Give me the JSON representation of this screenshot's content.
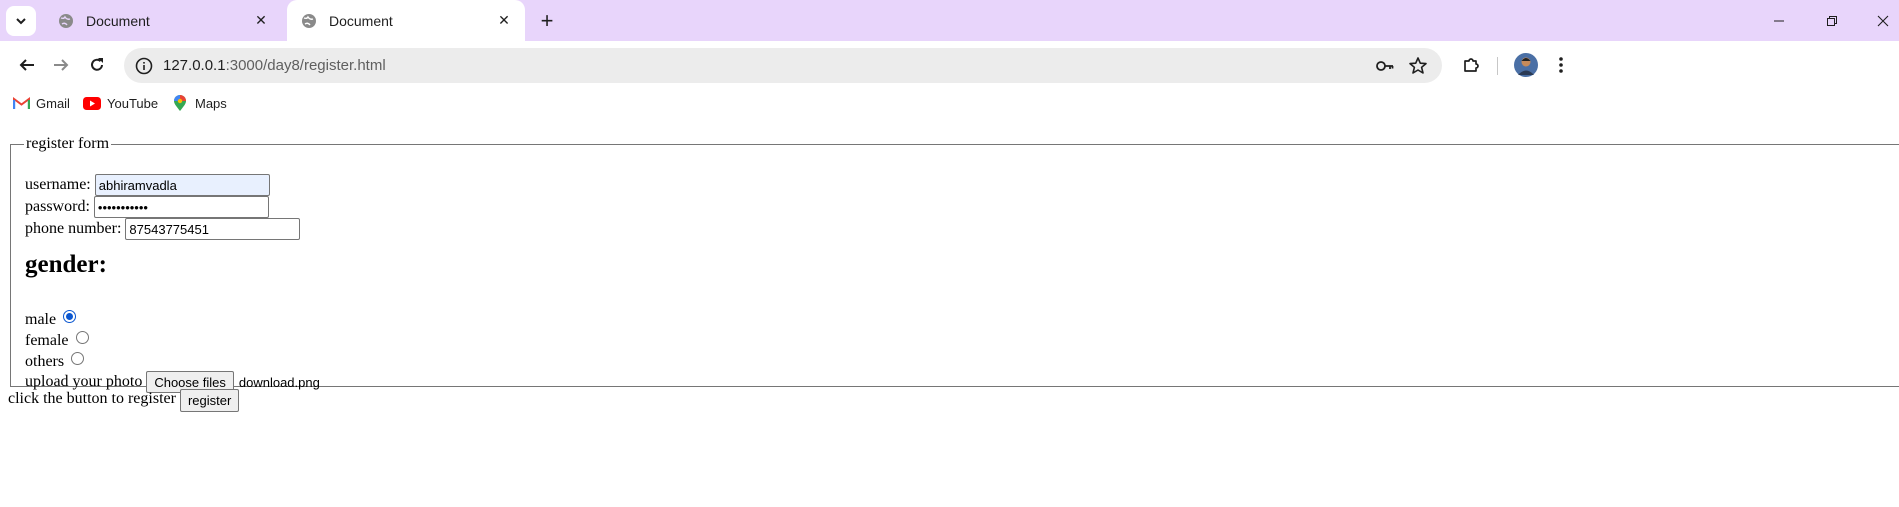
{
  "browser": {
    "tabs": [
      {
        "title": "Document",
        "active": false
      },
      {
        "title": "Document",
        "active": true
      }
    ],
    "address": {
      "host": "127.0.0.1",
      "path": ":3000/day8/register.html"
    },
    "bookmarks": [
      {
        "label": "Gmail",
        "icon": "gmail-icon"
      },
      {
        "label": "YouTube",
        "icon": "youtube-icon"
      },
      {
        "label": "Maps",
        "icon": "maps-icon"
      }
    ]
  },
  "form": {
    "legend": "register form",
    "username": {
      "label": "username:",
      "value": "abhiramvadla"
    },
    "password": {
      "label": "password:",
      "value": "•••••••••••"
    },
    "phone": {
      "label": "phone number:",
      "value": "87543775451"
    },
    "gender_heading": "gender:",
    "gender_options": [
      {
        "label": "male",
        "checked": true
      },
      {
        "label": "female",
        "checked": false
      },
      {
        "label": "others",
        "checked": false
      }
    ],
    "upload": {
      "label": "upload your photo",
      "button": "Choose files",
      "filename": "download.png"
    }
  },
  "footer": {
    "text": "click the button to register",
    "button": "register"
  },
  "colors": {
    "tabstrip": "#e8d5fb",
    "accent": "#0b57d0",
    "autofill": "#e8f0fe"
  }
}
